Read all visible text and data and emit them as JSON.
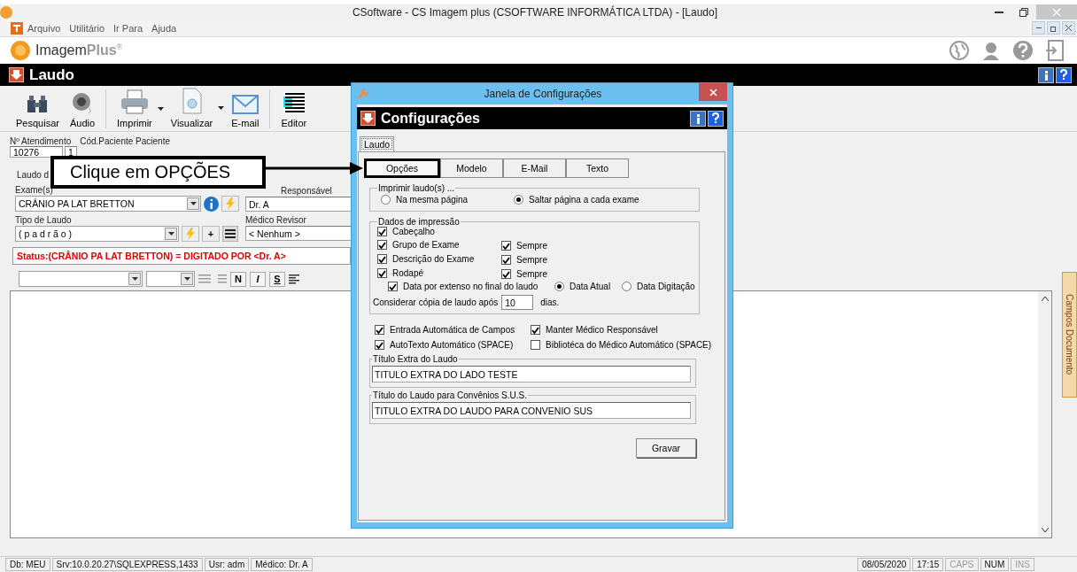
{
  "window": {
    "title": "CSoftware - CS Imagem plus (CSOFTWARE INFORMÁTICA LTDA) - [Laudo]"
  },
  "menu": [
    "Arquivo",
    "Utilitário",
    "Ir Para",
    "Ajuda"
  ],
  "brand": {
    "name": "Imagem",
    "suffix": "Plus",
    "mark": "®"
  },
  "module_title": "Laudo",
  "toolbar": [
    {
      "label": "Pesquisar",
      "kind": "binoculars",
      "dropdown": false
    },
    {
      "label": "Áudio",
      "kind": "speaker",
      "dropdown": false
    },
    {
      "label": "Imprimir",
      "kind": "printer",
      "dropdown": true
    },
    {
      "label": "Visualizar",
      "kind": "preview",
      "dropdown": true
    },
    {
      "label": "E-mail",
      "kind": "mail",
      "dropdown": false
    },
    {
      "label": "Editor",
      "kind": "editor",
      "dropdown": false
    }
  ],
  "header": {
    "labels": [
      "Nº Atendimento",
      "Cód.Paciente Paciente"
    ],
    "values": [
      "10276",
      "1"
    ]
  },
  "form": {
    "tab": "Laudo d",
    "exam_label": "Exame(s)",
    "exam": "CRÂNIO PA LAT BRETTON",
    "responsible_label": "Responsável",
    "responsible": "Dr. A",
    "type_label": "Tipo de Laudo",
    "type": "( p a d r ã o )",
    "add": "+",
    "reviewer_label": "Médico Revisor",
    "reviewer": "< Nenhum >",
    "status": "Status:(CRÂNIO PA LAT BRETTON) = DIGITADO POR <Dr. A>"
  },
  "format_buttons": [
    "N",
    "I",
    "S"
  ],
  "side_tab": "Campos Documento",
  "status_bar": {
    "left": [
      "Db: MEU",
      "Srv:10.0.20.27\\SQLEXPRESS,1433",
      "Usr: adm",
      "Médico: Dr. A"
    ],
    "right": [
      {
        "text": "08/05/2020",
        "disabled": false
      },
      {
        "text": "17:15",
        "disabled": false
      },
      {
        "text": "CAPS",
        "disabled": true
      },
      {
        "text": "NUM",
        "disabled": false
      },
      {
        "text": "INS",
        "disabled": true
      }
    ]
  },
  "dialog": {
    "title": "Janela de Configurações",
    "header": "Configurações",
    "tab": "Laudo",
    "subtabs": [
      {
        "label": "Opções",
        "selected": true
      },
      {
        "label": "Modelo",
        "selected": false
      },
      {
        "label": "E-Mail",
        "selected": false
      },
      {
        "label": "Texto",
        "selected": false
      }
    ],
    "print_group": {
      "title": "Imprimir laudo(s) ...",
      "options": [
        {
          "label": "Na mesma página",
          "selected": false
        },
        {
          "label": "Saltar página a cada exame",
          "selected": true
        }
      ]
    },
    "data_group": {
      "title": "Dados de impressão",
      "items": [
        {
          "label": "Cabeçalho",
          "checked": true
        },
        {
          "label": "Grupo de Exame",
          "checked": true,
          "always": {
            "label": "Sempre",
            "checked": true
          }
        },
        {
          "label": "Descrição do Exame",
          "checked": true,
          "always": {
            "label": "Sempre",
            "checked": true
          }
        },
        {
          "label": "Rodapé",
          "checked": true,
          "always": {
            "label": "Sempre",
            "checked": true
          }
        }
      ],
      "date_option": {
        "label": "Data por extenso no final do laudo",
        "checked": true
      },
      "date_choice": [
        {
          "label": "Data Atual",
          "selected": true
        },
        {
          "label": "Data Digitação",
          "selected": false
        }
      ],
      "copy": {
        "before": "Considerar cópia de laudo após",
        "value": "10",
        "after": "dias."
      }
    },
    "options": [
      {
        "label": "Entrada Automática de Campos",
        "checked": true
      },
      {
        "label": "Manter Médico Responsável",
        "checked": true
      },
      {
        "label": "AutoTexto Automático (SPACE)",
        "checked": true
      },
      {
        "label": "Bibliotéca do Médico Automático (SPACE)",
        "checked": false
      }
    ],
    "title_fields": [
      {
        "legend": "Título Extra do Laudo",
        "value": "TITULO EXTRA DO LADO TESTE"
      },
      {
        "legend": "Título do Laudo para Convênios S.U.S.",
        "value": "TITULO EXTRA DO LAUDO PARA CONVENIO SUS"
      }
    ],
    "save": "Gravar"
  },
  "callout": "Clique em OPÇÕES"
}
